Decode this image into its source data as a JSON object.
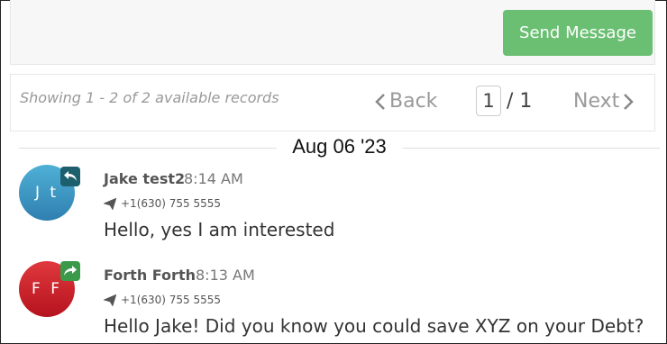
{
  "compose": {
    "send_label": "Send Message"
  },
  "pagination": {
    "summary": "Showing 1 - 2 of 2 available records",
    "back_label": "Back",
    "current_page": "1",
    "total_pages": "/ 1",
    "next_label": "Next"
  },
  "date_separator": "Aug 06 '23",
  "messages": [
    {
      "initials": "J t",
      "sender": "Jake test2",
      "time": "8:14 AM",
      "phone": "+1(630) 755 5555",
      "text": "Hello, yes I am interested",
      "direction": "incoming",
      "avatar_color": "#3d98c6"
    },
    {
      "initials": "F F",
      "sender": "Forth Forth",
      "time": "8:13 AM",
      "phone": "+1(630) 755 5555",
      "text": "Hello Jake! Did you know you could save XYZ on your Debt?",
      "direction": "outgoing",
      "avatar_color": "#cc2229"
    }
  ],
  "colors": {
    "send_button": "#6abf72",
    "incoming_badge": "#1e5f6e",
    "outgoing_badge": "#3a9a4a"
  }
}
